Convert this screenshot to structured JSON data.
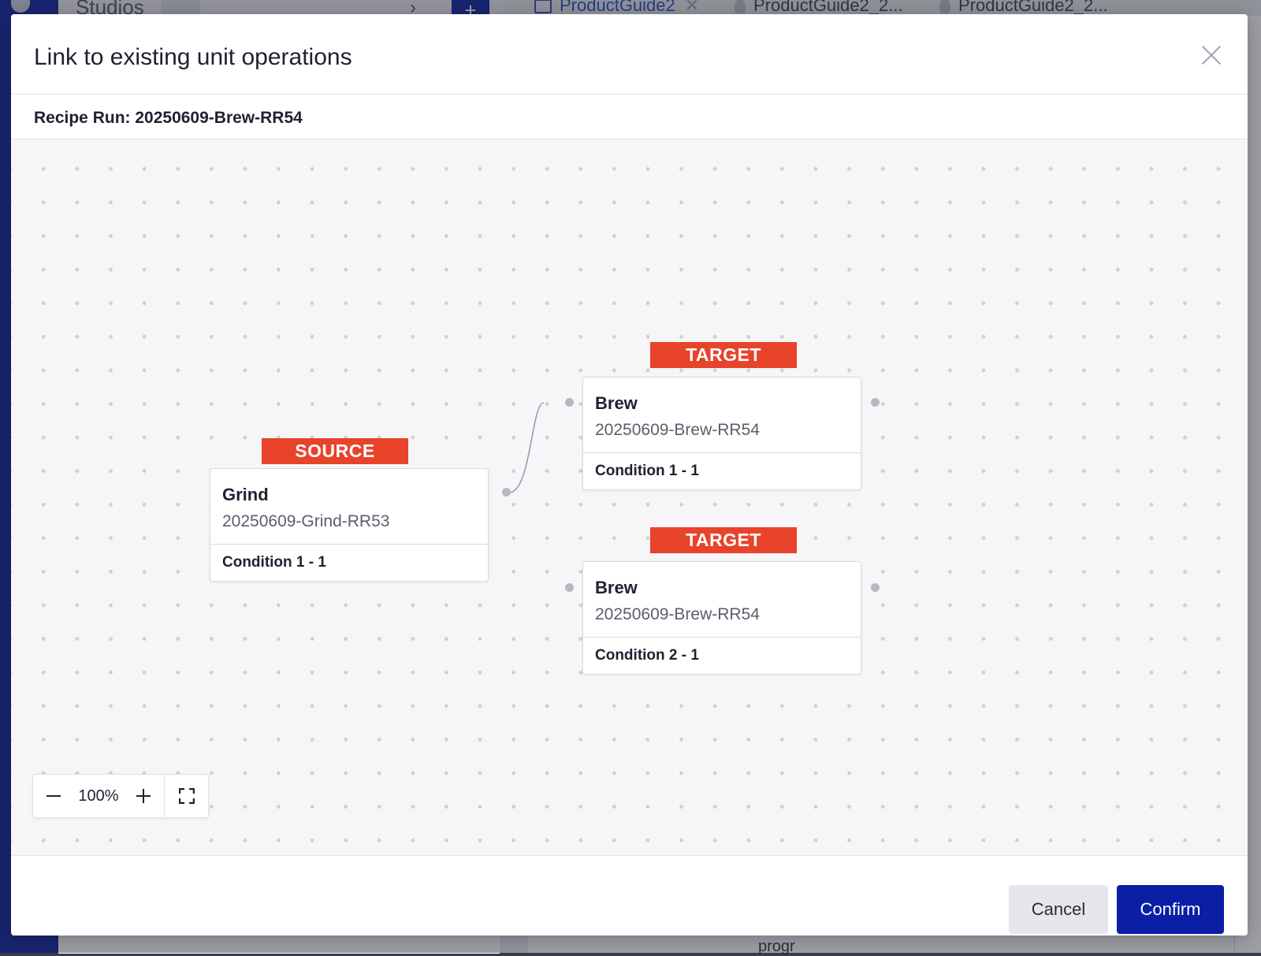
{
  "background": {
    "left_label": "Studios",
    "tabs": [
      {
        "label": "ProductGuide2",
        "active": true
      },
      {
        "label": "ProductGuide2_2...",
        "active": false
      },
      {
        "label": "ProductGuide2_2...",
        "active": false
      }
    ],
    "bottom_text": "progr"
  },
  "modal": {
    "title": "Link to existing unit operations",
    "recipe_run": "Recipe Run: 20250609-Brew-RR54",
    "source": {
      "badge": "SOURCE",
      "name": "Grind",
      "id": "20250609-Grind-RR53",
      "condition": "Condition 1 - 1"
    },
    "targets": [
      {
        "badge": "TARGET",
        "name": "Brew",
        "id": "20250609-Brew-RR54",
        "condition": "Condition 1 - 1"
      },
      {
        "badge": "TARGET",
        "name": "Brew",
        "id": "20250609-Brew-RR54",
        "condition": "Condition 2 - 1"
      }
    ],
    "zoom": {
      "value": "100%"
    },
    "buttons": {
      "cancel": "Cancel",
      "confirm": "Confirm"
    }
  },
  "colors": {
    "badge": "#e8432b",
    "primary": "#0a1ea6",
    "nav": "#0b1f9e"
  },
  "icons": [
    "close-icon",
    "zoom-out-icon",
    "zoom-in-icon",
    "fit-view-icon",
    "book-icon",
    "lightbulb-icon"
  ]
}
